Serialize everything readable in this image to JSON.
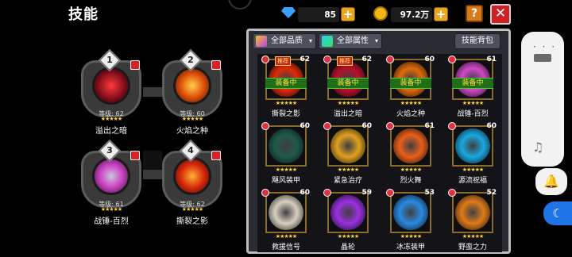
{
  "header": {
    "title": "技能"
  },
  "resources": {
    "gems": "85",
    "coins": "97.2万",
    "plus": "+"
  },
  "buttons": {
    "help": "?",
    "close": "✕"
  },
  "equipped": [
    {
      "num": "1",
      "level": "等级: 62",
      "stars": "★★★★★",
      "name": "溢出之暗",
      "color": "#c8102a"
    },
    {
      "num": "2",
      "level": "等级: 60",
      "stars": "★★★★★",
      "name": "火焰之种",
      "color": "#e05a0a"
    },
    {
      "num": "3",
      "level": "等级: 61",
      "stars": "★★★★★",
      "name": "战锤-百烈",
      "color": "#d048c8"
    },
    {
      "num": "4",
      "level": "等级: 62",
      "stars": "★★★★★",
      "name": "撕裂之影",
      "color": "#d8280a"
    }
  ],
  "filters": {
    "quality": "全部品质",
    "attribute": "全部属性",
    "bag": "技能背包",
    "caret": "▾"
  },
  "skills": [
    {
      "level": "62",
      "name": "撕裂之影",
      "equipped": true,
      "recommend": true,
      "color": "#e02a0a"
    },
    {
      "level": "62",
      "name": "溢出之暗",
      "equipped": true,
      "recommend": true,
      "color": "#b8102a"
    },
    {
      "level": "60",
      "name": "火焰之种",
      "equipped": true,
      "recommend": false,
      "color": "#e06a0a"
    },
    {
      "level": "61",
      "name": "战锤-百烈",
      "equipped": true,
      "recommend": false,
      "color": "#d048c8"
    },
    {
      "level": "60",
      "name": "飓风装甲",
      "equipped": false,
      "recommend": false,
      "color": "#1f5a4a"
    },
    {
      "level": "60",
      "name": "紧急治疗",
      "equipped": false,
      "recommend": false,
      "color": "#e0a020"
    },
    {
      "level": "61",
      "name": "烈火舞",
      "equipped": false,
      "recommend": false,
      "color": "#e8601a"
    },
    {
      "level": "60",
      "name": "源流祝福",
      "equipped": false,
      "recommend": false,
      "color": "#1aa8e0"
    },
    {
      "level": "60",
      "name": "救援信号",
      "equipped": false,
      "recommend": false,
      "color": "#d8d0c0"
    },
    {
      "level": "59",
      "name": "晶轮",
      "equipped": false,
      "recommend": false,
      "color": "#9a30e0"
    },
    {
      "level": "53",
      "name": "冰冻装甲",
      "equipped": false,
      "recommend": false,
      "color": "#2a8ae0"
    },
    {
      "level": "52",
      "name": "野蛮之力",
      "equipped": false,
      "recommend": false,
      "color": "#e07a1a"
    }
  ],
  "labels": {
    "equipped": "装备中",
    "recommend": "推荐",
    "stars": "★★★★★"
  },
  "side": {
    "dots": "· · ·",
    "note": "♫",
    "bell": "🔔",
    "moon": "☾"
  }
}
